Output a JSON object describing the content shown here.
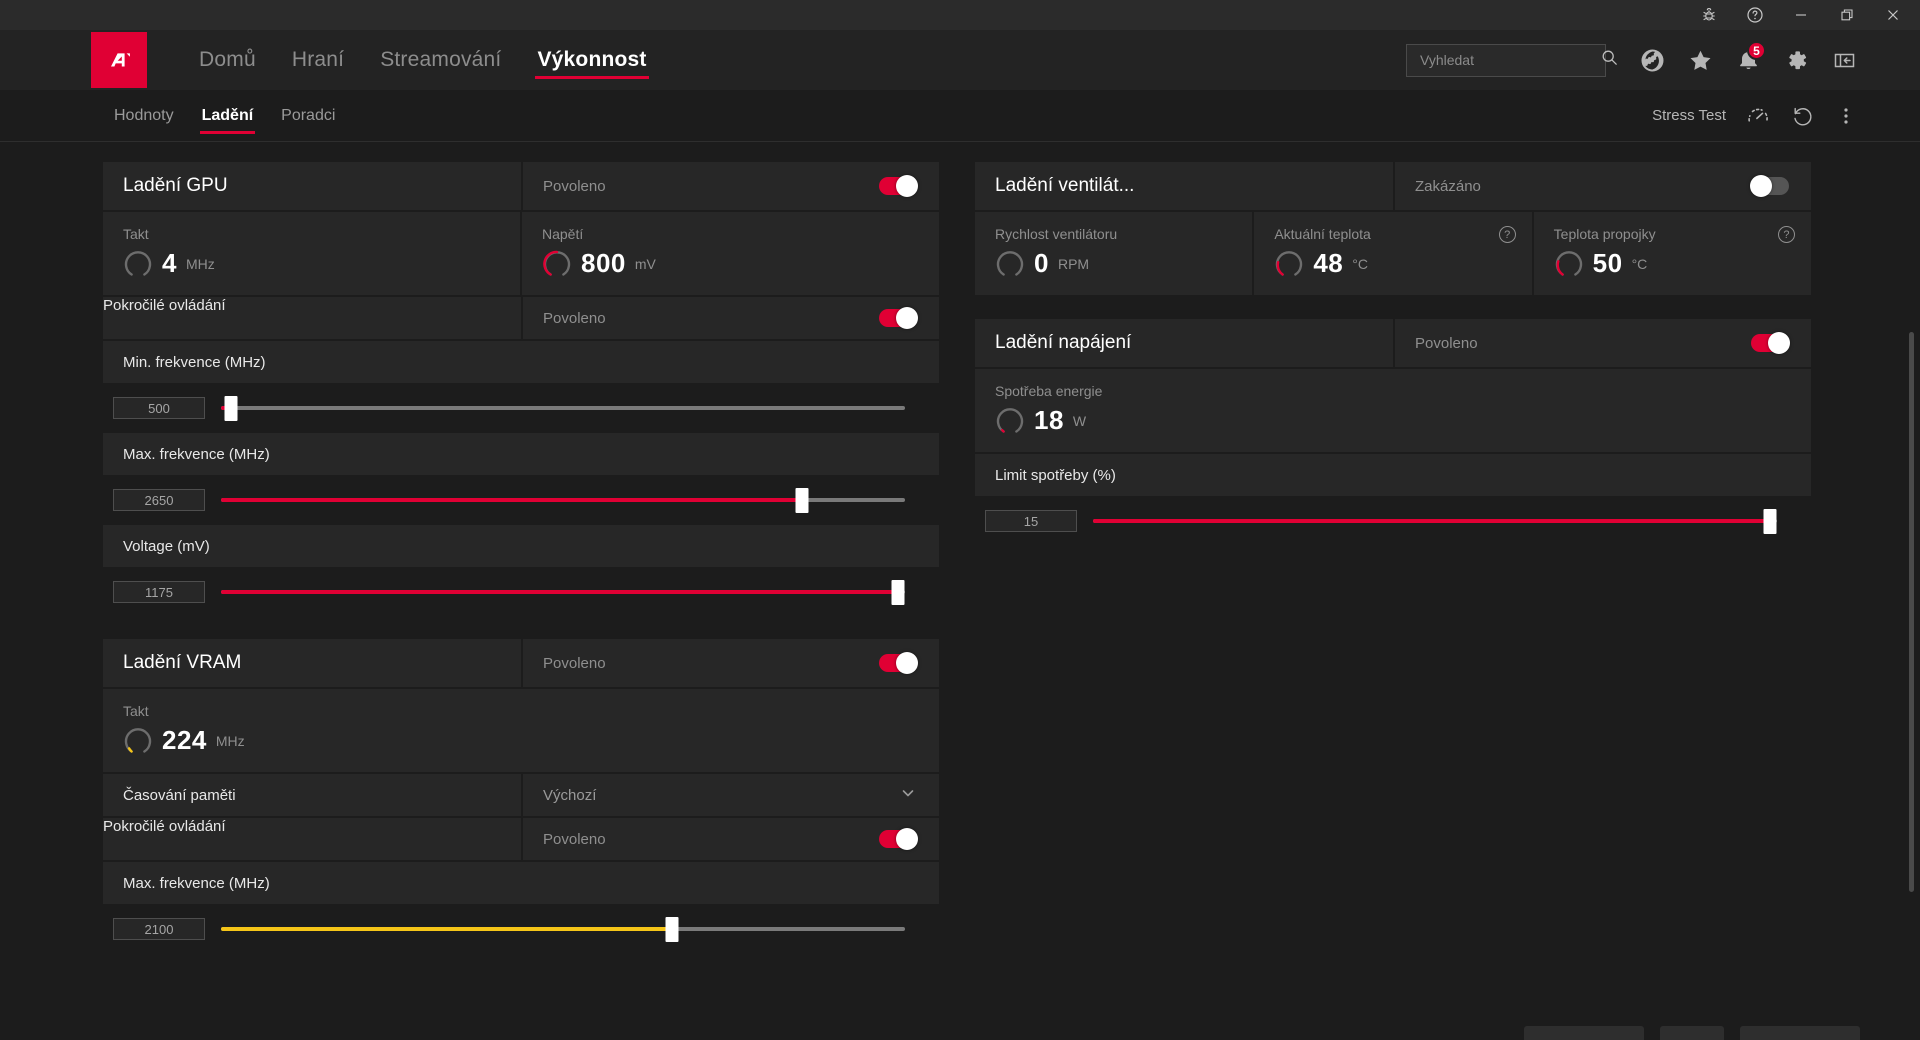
{
  "titlebar": {
    "buttons": [
      {
        "name": "bug-report-icon",
        "label": ""
      },
      {
        "name": "help-icon",
        "label": ""
      },
      {
        "name": "minimize-icon",
        "label": ""
      },
      {
        "name": "restore-icon",
        "label": ""
      },
      {
        "name": "close-icon",
        "label": ""
      }
    ]
  },
  "nav": {
    "logo_alt": "AMD",
    "items": [
      {
        "label": "Domů",
        "active": false
      },
      {
        "label": "Hraní",
        "active": false
      },
      {
        "label": "Streamování",
        "active": false
      },
      {
        "label": "Výkonnost",
        "active": true
      }
    ],
    "search": {
      "placeholder": "Vyhledat",
      "value": ""
    },
    "icons": [
      {
        "name": "globe-icon"
      },
      {
        "name": "star-icon"
      },
      {
        "name": "bell-icon",
        "badge": "5"
      },
      {
        "name": "gear-icon"
      },
      {
        "name": "collapse-panel-icon"
      }
    ]
  },
  "subnav": {
    "items": [
      {
        "label": "Hodnoty",
        "active": false
      },
      {
        "label": "Ladění",
        "active": true
      },
      {
        "label": "Poradci",
        "active": false
      }
    ],
    "stress_test_label": "Stress Test",
    "reset_icon": "undo-icon",
    "more_icon": "more-vertical-icon"
  },
  "gpu_tuning": {
    "title": "Ladění GPU",
    "toggle_label": "Povoleno",
    "toggle_on": true,
    "metrics": [
      {
        "label": "Takt",
        "value": "4",
        "unit": "MHz",
        "arc_pct": 2,
        "arc_color": "#8a8a8a"
      },
      {
        "label": "Napětí",
        "value": "800",
        "unit": "mV",
        "arc_pct": 55,
        "arc_color": "#e00034"
      }
    ],
    "advanced": {
      "label": "Pokročilé ovládání",
      "toggle_label": "Povoleno",
      "toggle_on": true
    },
    "sliders": [
      {
        "label": "Min. frekvence (MHz)",
        "value": "500",
        "pct": 1.5,
        "color": "red"
      },
      {
        "label": "Max. frekvence (MHz)",
        "value": "2650",
        "pct": 85,
        "color": "red"
      },
      {
        "label": "Voltage (mV)",
        "value": "1175",
        "pct": 99,
        "color": "red"
      }
    ]
  },
  "vram_tuning": {
    "title": "Ladění VRAM",
    "toggle_label": "Povoleno",
    "toggle_on": true,
    "metrics": [
      {
        "label": "Takt",
        "value": "224",
        "unit": "MHz",
        "arc_pct": 8,
        "arc_color": "#f5c518"
      }
    ],
    "memory_timing": {
      "label": "Časování paměti",
      "value": "Výchozí"
    },
    "advanced": {
      "label": "Pokročilé ovládání",
      "toggle_label": "Povoleno",
      "toggle_on": true
    },
    "sliders": [
      {
        "label": "Max. frekvence (MHz)",
        "value": "2100",
        "pct": 66,
        "color": "amber"
      }
    ]
  },
  "fan_tuning": {
    "title": "Ladění ventilát...",
    "toggle_label": "Zakázáno",
    "toggle_on": false,
    "metrics": [
      {
        "label": "Rychlost ventilátoru",
        "value": "0",
        "unit": "RPM",
        "arc_pct": 0,
        "arc_color": "#8a8a8a",
        "help": false
      },
      {
        "label": "Aktuální teplota",
        "value": "48",
        "unit": "°C",
        "arc_pct": 32,
        "arc_color": "#e00034",
        "help": true
      },
      {
        "label": "Teplota propojky",
        "value": "50",
        "unit": "°C",
        "arc_pct": 34,
        "arc_color": "#e00034",
        "help": true
      }
    ]
  },
  "power_tuning": {
    "title": "Ladění napájení",
    "toggle_label": "Povoleno",
    "toggle_on": true,
    "metrics": [
      {
        "label": "Spotřeba energie",
        "value": "18",
        "unit": "W",
        "arc_pct": 5,
        "arc_color": "#e00034"
      }
    ],
    "sliders": [
      {
        "label": "Limit spotřeby (%)",
        "value": "15",
        "pct": 99,
        "color": "red"
      }
    ]
  },
  "colors": {
    "accent": "#e00034",
    "amber": "#f5c518",
    "panel": "#272727",
    "background": "#1c1c1c",
    "navbar": "#232323"
  }
}
